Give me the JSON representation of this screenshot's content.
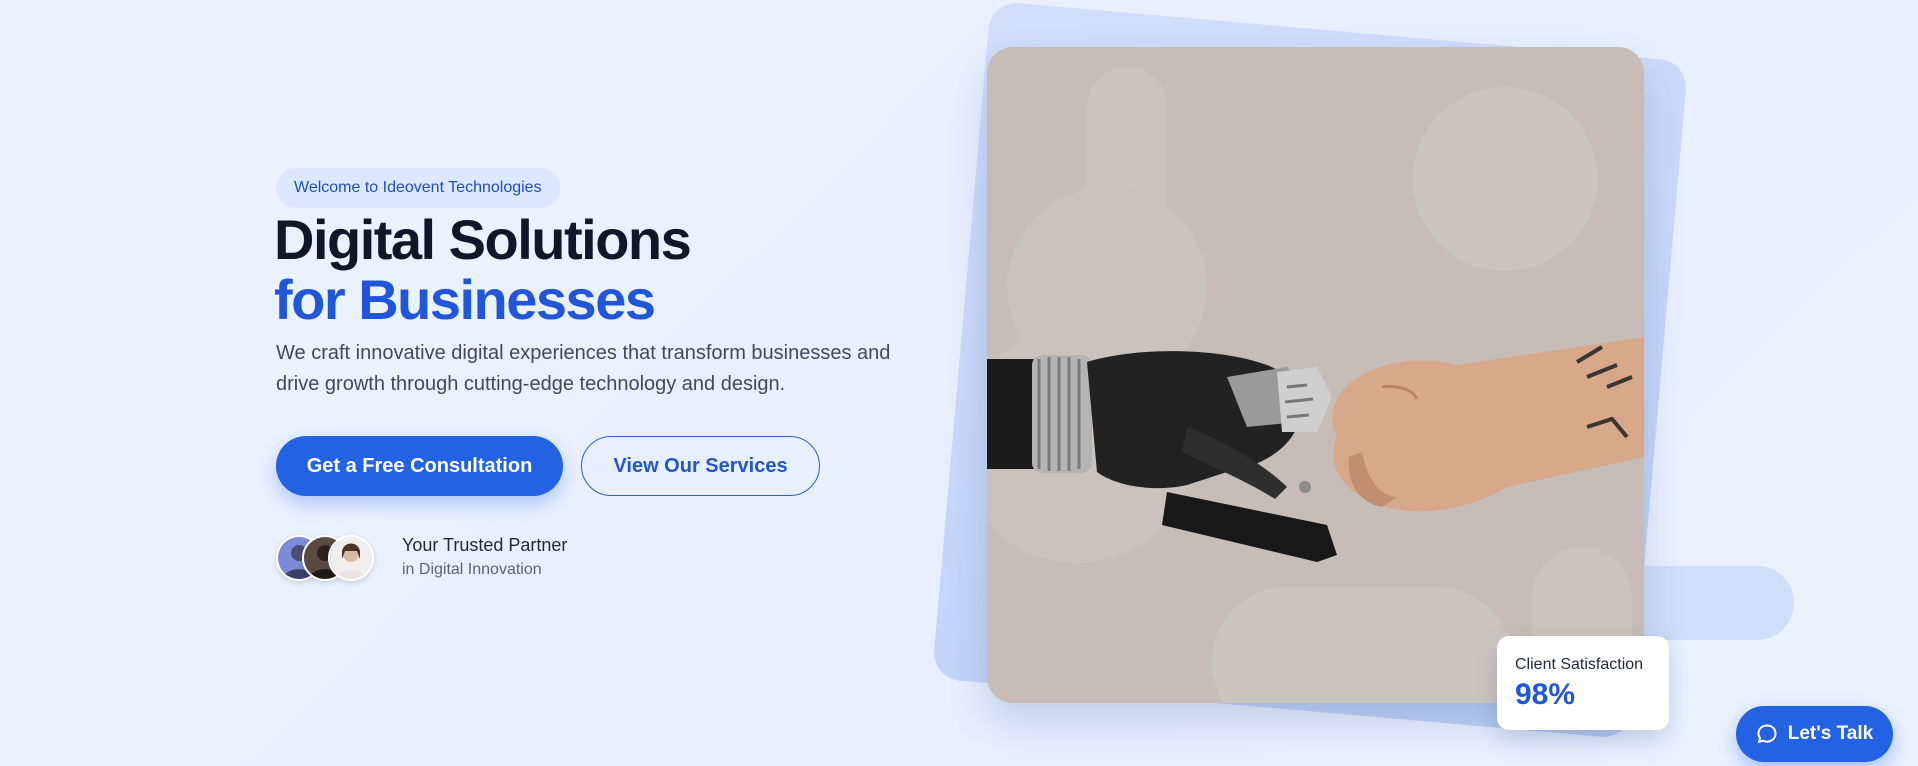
{
  "hero": {
    "badge": "Welcome to Ideovent Technologies",
    "title_line1": "Digital Solutions",
    "title_line2": "for Businesses",
    "subtitle": "We craft innovative digital experiences that transform businesses and drive growth through cutting-edge technology and design.",
    "primary_button": "Get a Free Consultation",
    "secondary_button": "View Our Services",
    "trust_title": "Your Trusted Partner",
    "trust_subtitle": "in Digital Innovation",
    "avatars": [
      "avatar-1",
      "avatar-2",
      "avatar-3"
    ]
  },
  "visual": {
    "image_subject": "robotic-hand-fist-bump-human-hand",
    "stat_label": "Client Satisfaction",
    "stat_value": "98%"
  },
  "chat": {
    "label": "Let's Talk",
    "icon": "chat-bubble-icon"
  },
  "colors": {
    "primary": "#2462e4",
    "accent_text": "#2256d8",
    "heading": "#0f172a",
    "background": "#eef4ff",
    "badge_bg": "#dce8ff"
  }
}
